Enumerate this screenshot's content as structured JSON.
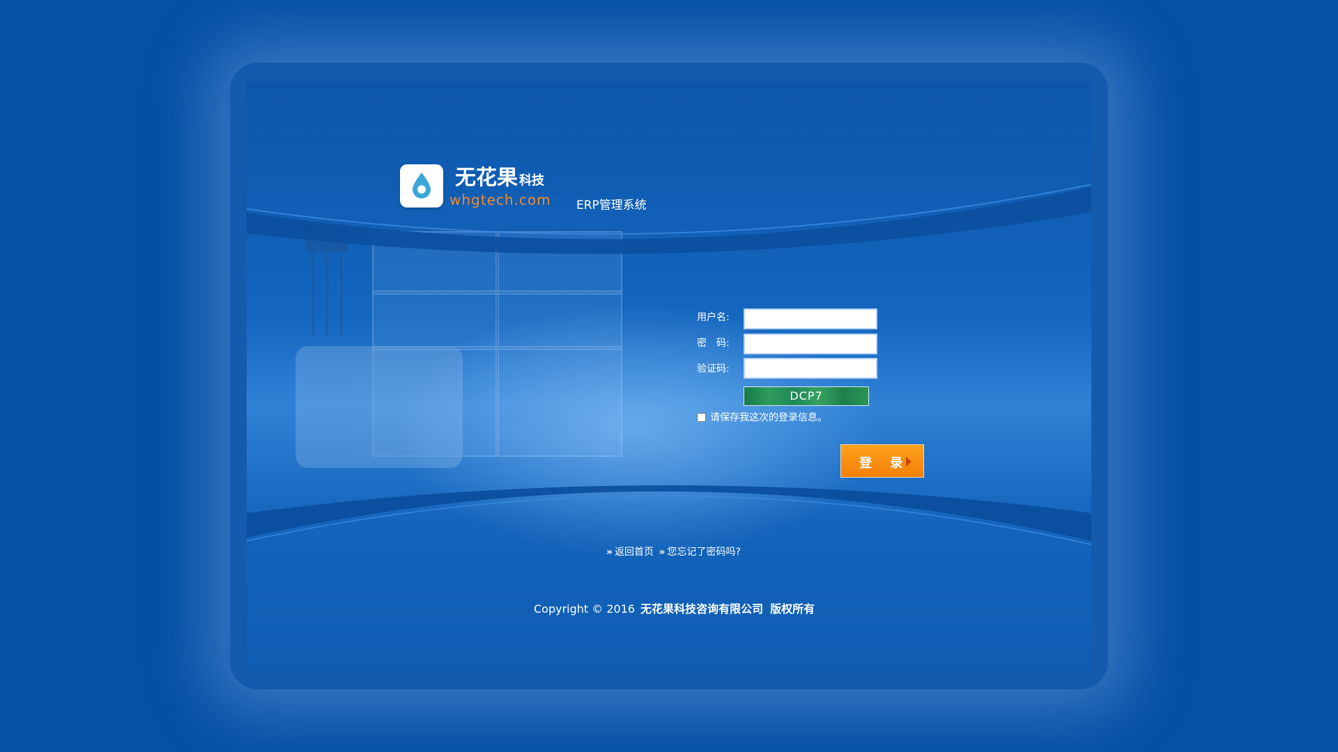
{
  "brand": {
    "name": "无花果",
    "name_suffix": "科技",
    "domain": "whgtech.com",
    "system_title": "ERP管理系统",
    "logo_icon": "water-drop-icon"
  },
  "login_form": {
    "username_label": "用户名:",
    "username_value": "",
    "password_label": "密　码:",
    "password_value": "",
    "captcha_label": "验证码:",
    "captcha_value": "",
    "captcha_image_text": "DCP7",
    "remember_label": "请保存我这次的登录信息。",
    "remember_checked": false,
    "submit_label": "登 录"
  },
  "footer": {
    "link_sep": "»",
    "home_link": "返回首页",
    "forgot_link": "您忘记了密码吗?",
    "copyright_prefix": "Copyright © 2016",
    "company": "无花果科技咨询有限公司",
    "rights": "版权所有"
  },
  "colors": {
    "background": "#0650a6",
    "accent_orange": "#f47f0a",
    "domain_orange": "#f08b2e",
    "captcha_green": "#22875a"
  }
}
